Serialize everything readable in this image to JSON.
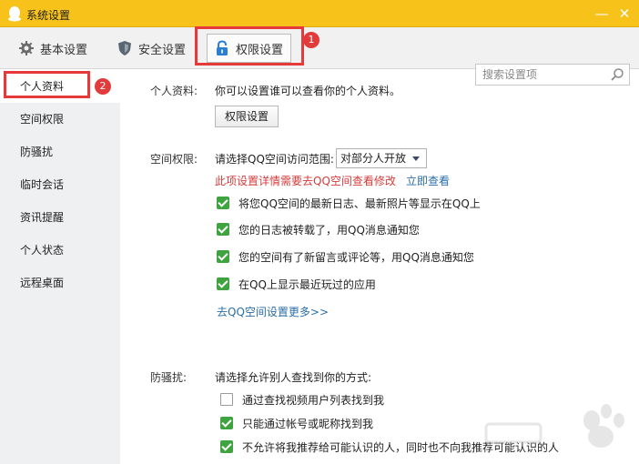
{
  "window": {
    "title": "系统设置",
    "minimize_glyph": "—",
    "close_glyph": "✕",
    "titlebar_color": "#f7c21a"
  },
  "toolbar": {
    "tabs": [
      {
        "label": "基本设置",
        "icon": "gear-icon"
      },
      {
        "label": "安全设置",
        "icon": "shield-icon"
      },
      {
        "label": "权限设置",
        "icon": "lock-icon",
        "selected": true
      }
    ],
    "search_placeholder": "搜索设置项"
  },
  "annotations": {
    "marker1": "1",
    "marker2": "2",
    "highlight_color": "#e63a3a"
  },
  "sidebar": {
    "items": [
      {
        "label": "个人资料",
        "active": true
      },
      {
        "label": "空间权限"
      },
      {
        "label": "防骚扰"
      },
      {
        "label": "临时会话"
      },
      {
        "label": "资讯提醒"
      },
      {
        "label": "个人状态"
      },
      {
        "label": "远程桌面"
      }
    ]
  },
  "profile": {
    "label": "个人资料:",
    "description": "你可以设置谁可以查看你的个人资料。",
    "button": "权限设置"
  },
  "space": {
    "label": "空间权限:",
    "range_label": "请选择QQ空间访问范围:",
    "range_value": "对部分人开放",
    "notice": "此项设置详情需要去QQ空间查看修改",
    "notice_link": "立即查看",
    "options": [
      {
        "label": "将您QQ空间的最新日志、最新照片等显示在QQ上",
        "checked": true
      },
      {
        "label": "您的日志被转载了，用QQ消息通知您",
        "checked": true
      },
      {
        "label": "您的空间有了新留言或评论等，用QQ消息通知您",
        "checked": true
      },
      {
        "label": "在QQ上显示最近玩过的应用",
        "checked": true
      }
    ],
    "more_link": "去QQ空间设置更多>>"
  },
  "antispam": {
    "label": "防骚扰:",
    "prompt": "请选择允许别人查找到你的方式:",
    "options": [
      {
        "label": "通过查找视频用户列表找到我",
        "checked": false
      },
      {
        "label": "只能通过帐号或昵称找到我",
        "checked": true
      },
      {
        "label": "不允许将我推荐给可能认识的人，同时也不向我推荐可能认识的人",
        "checked": true
      }
    ]
  },
  "colors": {
    "check_green": "#3fa340",
    "link_blue": "#2a6ea8",
    "notice_red": "#d43c3c"
  }
}
